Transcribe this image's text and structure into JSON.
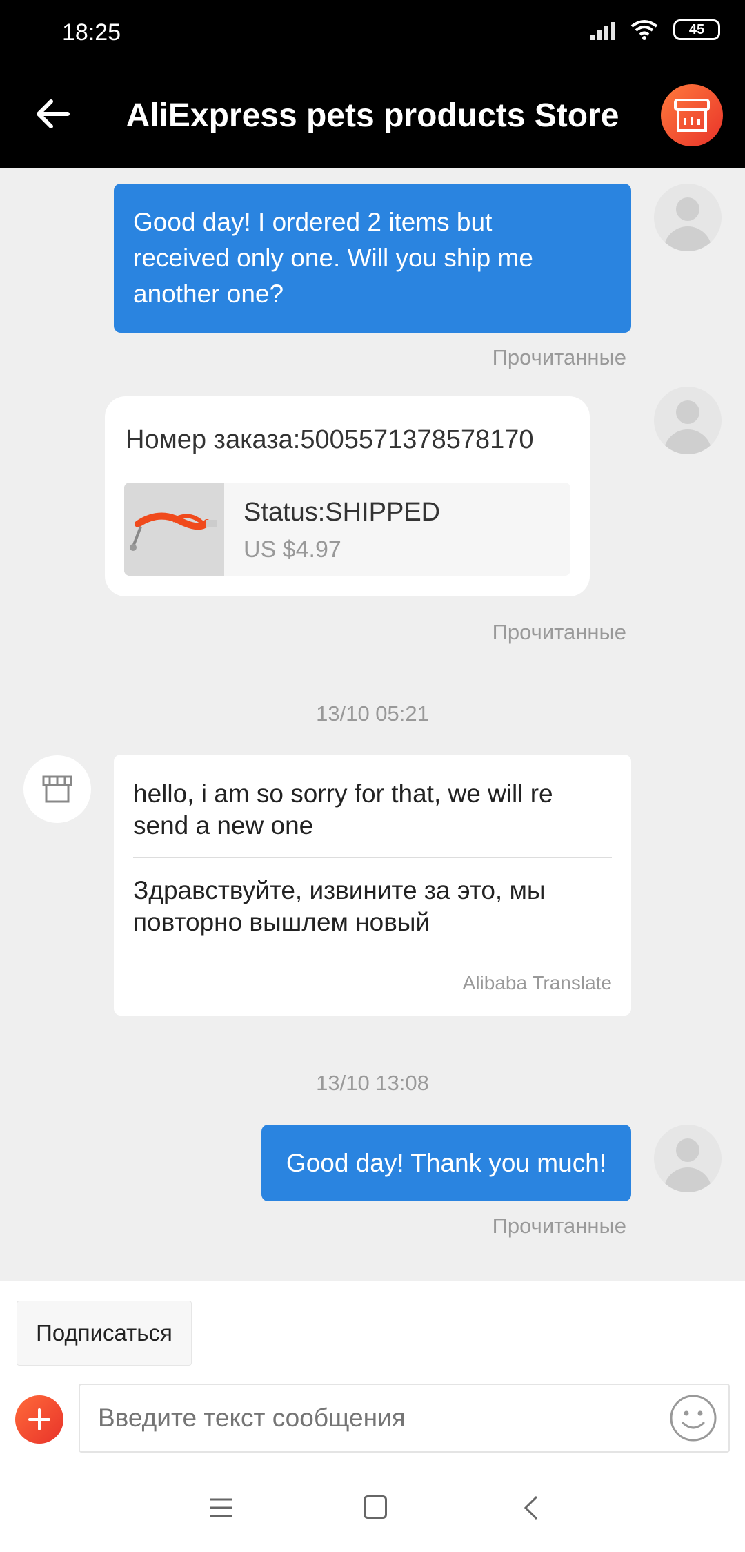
{
  "status_bar": {
    "time": "18:25",
    "battery": "45"
  },
  "header": {
    "title": "AliExpress pets products Store"
  },
  "messages": {
    "msg1": {
      "line1": "Good day! I ordered 2 items but",
      "line2": "received only one. Will you ship me",
      "line3": "another one?",
      "read": "Прочитанные"
    },
    "order": {
      "number": "Номер заказа:5005571378578170",
      "status": "Status:SHIPPED",
      "price": "US $4.97",
      "read": "Прочитанные"
    },
    "timestamp1": "13/10 05:21",
    "reply": {
      "original_line1": "hello, i am so sorry for that, we will re",
      "original_line2": "send a new one",
      "translated_line1": "Здравствуйте, извините за это, мы",
      "translated_line2": "повторно вышлем новый",
      "provider": "Alibaba Translate"
    },
    "timestamp2": "13/10 13:08",
    "msg2": {
      "text": "Good day! Thank you much!",
      "read": "Прочитанные"
    }
  },
  "bottom": {
    "subscribe_label": "Подписаться",
    "input_placeholder": "Введите текст сообщения"
  },
  "colors": {
    "accent_blue": "#2a84e0",
    "brand_orange": "#f04b2a"
  }
}
